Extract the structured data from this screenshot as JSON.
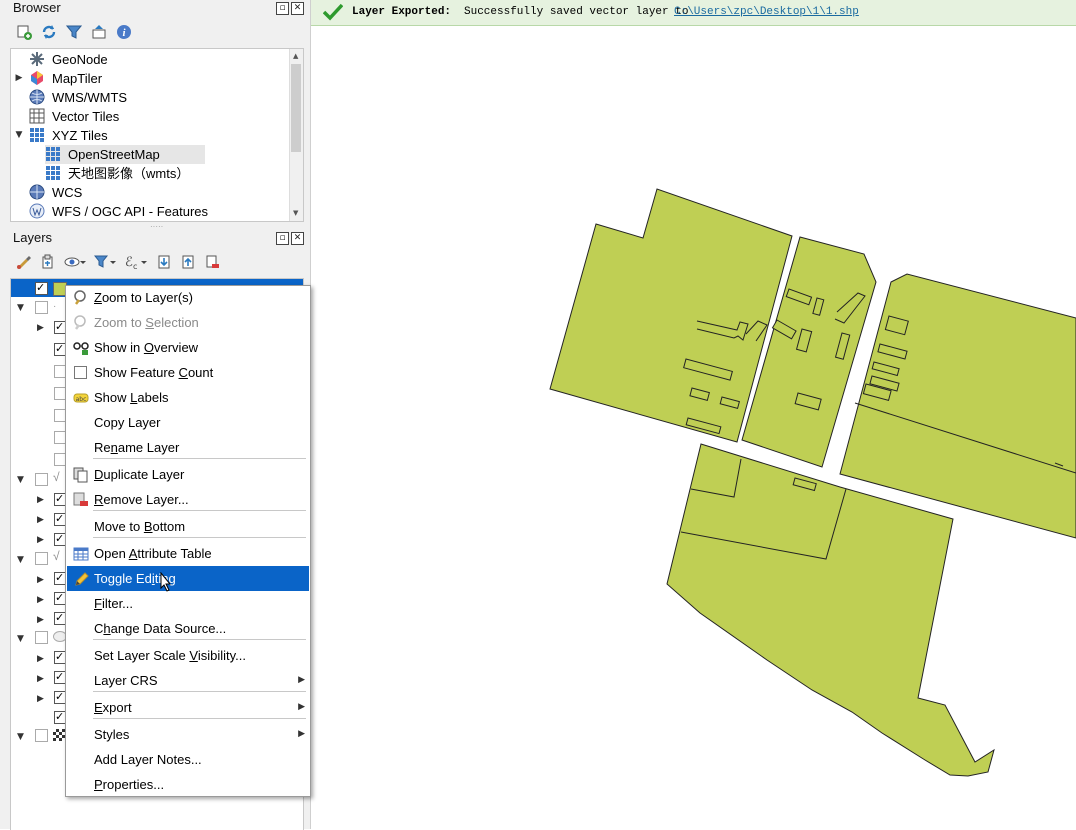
{
  "browser": {
    "title": "Browser",
    "items": [
      {
        "label": "GeoNode",
        "icon": "geonode-icon",
        "expander": ""
      },
      {
        "label": "MapTiler",
        "icon": "maptiler-icon",
        "expander": "▶"
      },
      {
        "label": "WMS/WMTS",
        "icon": "wms-icon",
        "expander": ""
      },
      {
        "label": "Vector Tiles",
        "icon": "vector-tiles-icon",
        "expander": ""
      },
      {
        "label": "XYZ Tiles",
        "icon": "xyz-tiles-icon",
        "expander": "▼"
      },
      {
        "label": "OpenStreetMap",
        "icon": "xyz-tiles-icon",
        "expander": ""
      },
      {
        "label": "天地图影像（wmts）",
        "icon": "xyz-tiles-icon",
        "expander": ""
      },
      {
        "label": "WCS",
        "icon": "wcs-icon",
        "expander": ""
      },
      {
        "label": "WFS / OGC API - Features",
        "icon": "wfs-icon",
        "expander": ""
      }
    ]
  },
  "layers": {
    "title": "Layers"
  },
  "context_menu": {
    "items": [
      {
        "label": "Zoom to Layer(s)",
        "mnemonic": "Z"
      },
      {
        "label": "Zoom to Selection",
        "mnemonic": "S",
        "disabled": true
      },
      {
        "label": "Show in Overview",
        "mnemonic": "O"
      },
      {
        "label": "Show Feature Count",
        "mnemonic": "C"
      },
      {
        "label": "Show Labels",
        "mnemonic": "L"
      },
      {
        "label": "Copy Layer"
      },
      {
        "label": "Rename Layer",
        "mnemonic": "n"
      },
      {
        "label": "Duplicate Layer",
        "mnemonic": "D"
      },
      {
        "label": "Remove Layer...",
        "mnemonic": "R"
      },
      {
        "label": "Move to Bottom",
        "mnemonic": "B"
      },
      {
        "label": "Open Attribute Table",
        "mnemonic": "A"
      },
      {
        "label": "Toggle Editing",
        "mnemonic": "i"
      },
      {
        "label": "Filter...",
        "mnemonic": "F"
      },
      {
        "label": "Change Data Source...",
        "mnemonic": "h"
      },
      {
        "label": "Set Layer Scale Visibility...",
        "mnemonic": "V"
      },
      {
        "label": "Layer CRS"
      },
      {
        "label": "Export",
        "mnemonic": "E"
      },
      {
        "label": "Styles"
      },
      {
        "label": "Add Layer Notes..."
      },
      {
        "label": "Properties...",
        "mnemonic": "P"
      }
    ]
  },
  "message_bar": {
    "title": "Layer Exported:",
    "text": "Successfully saved vector layer to",
    "link": "C:\\Users\\zpc\\Desktop\\1\\1.shp",
    "accent_color": "#2e9a2e"
  },
  "map": {
    "polygon_fill": "#bfcf54",
    "polygon_stroke": "#232323"
  }
}
